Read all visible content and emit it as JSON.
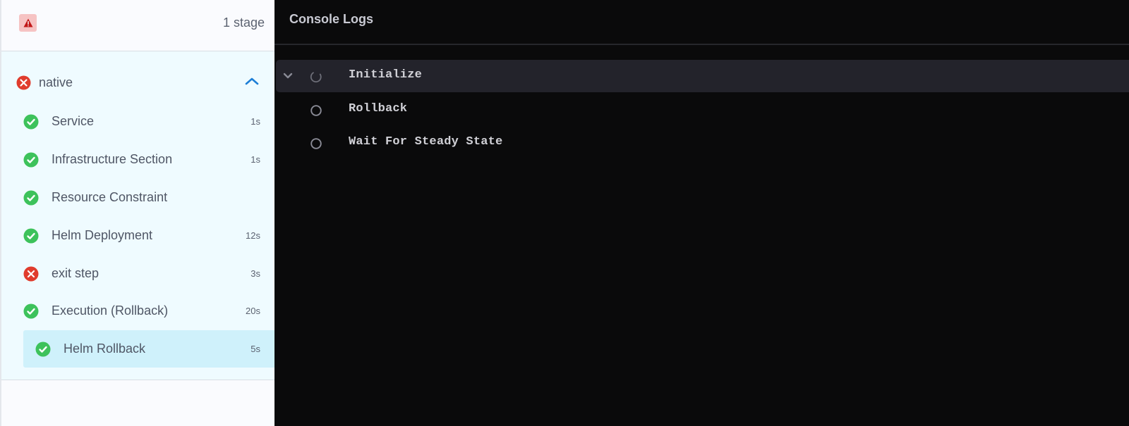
{
  "sidebar": {
    "header": {
      "status_icon": "warning-icon",
      "stage_count": "1 stage"
    },
    "stage": {
      "name": "native",
      "status": "failed",
      "expanded": true,
      "steps": [
        {
          "name": "Service",
          "status": "success",
          "duration": "1s"
        },
        {
          "name": "Infrastructure Section",
          "status": "success",
          "duration": "1s"
        },
        {
          "name": "Resource Constraint",
          "status": "success",
          "duration": ""
        },
        {
          "name": "Helm Deployment",
          "status": "success",
          "duration": "12s"
        },
        {
          "name": "exit step",
          "status": "failed",
          "duration": "3s"
        },
        {
          "name": "Execution (Rollback)",
          "status": "success",
          "duration": "20s"
        },
        {
          "name": "Helm Rollback",
          "status": "success",
          "duration": "5s",
          "selected": true
        }
      ]
    }
  },
  "console": {
    "title": "Console Logs",
    "sections": [
      {
        "label": "Initialize",
        "status": "running",
        "expanded": true
      },
      {
        "label": "Rollback",
        "status": "pending"
      },
      {
        "label": "Wait For Steady State",
        "status": "pending"
      }
    ]
  },
  "colors": {
    "success": "#3dc25b",
    "failed": "#e03c2d",
    "accent": "#1d7ed6",
    "selected_bg": "#cff1fb"
  }
}
